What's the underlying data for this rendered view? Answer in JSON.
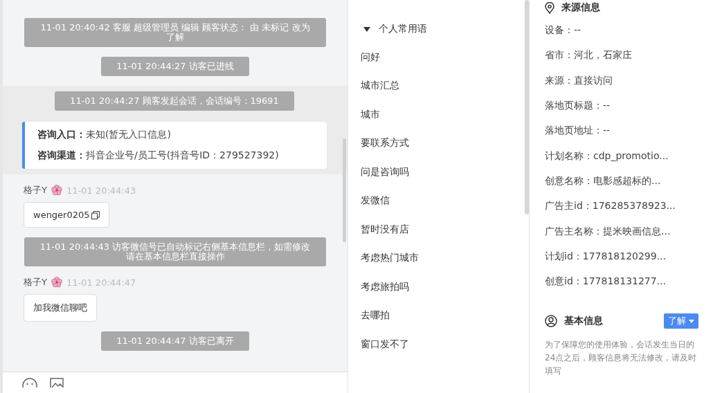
{
  "chat": {
    "messages": [
      {
        "kind": "notice",
        "wide": true,
        "text": "11-01 20:40:42 客服 超级管理员 编辑 顾客状态： 由 未标记 改为了解"
      },
      {
        "kind": "notice",
        "wide": false,
        "text": "11-01 20:44:27 访客已进线"
      },
      {
        "kind": "session",
        "text": "11-01 20:44:27 顾客发起会话，会话编号：19691",
        "fields": [
          {
            "label": "咨询入口：",
            "value": "未知(暂无入口信息)"
          },
          {
            "label": "咨询渠道：",
            "value": "抖音企业号/员工号(抖音号ID：279527392)"
          }
        ]
      },
      {
        "kind": "bubble",
        "sender": "格子Y",
        "time": "11-01 20:44:43",
        "text": "wenger0205",
        "copyable": true
      },
      {
        "kind": "notice",
        "wide": true,
        "text": "11-01 20:44:43 访客微信号已自动标记右侧基本信息栏，如需修改请在基本信息栏直接操作"
      },
      {
        "kind": "bubble",
        "sender": "格子Y",
        "time": "11-01 20:44:47",
        "text": "加我微信聊吧",
        "copyable": false
      },
      {
        "kind": "notice",
        "wide": false,
        "text": "11-01 20:44:47 访客已离开"
      }
    ]
  },
  "phrases": {
    "group": "个人常用语",
    "expanded": true,
    "items": [
      "问好",
      "城市汇总",
      "城市",
      "要联系方式",
      "问是咨询吗",
      "发微信",
      "暂时没有店",
      "考虑热门城市",
      "考虑旅拍吗",
      "去哪拍",
      "窗口发不了"
    ]
  },
  "source_info": {
    "title": "来源信息",
    "rows": [
      "设备：--",
      "省市：河北，石家庄",
      "来源：直接访问",
      "落地页标题：--",
      "落地页地址：--",
      "计划名称：cdp_promotio...",
      "创意名称：电影感超标的...",
      "广告主id：176285378923...",
      "广告主名称：提米映画信息...",
      "计划id：177818120299...",
      "创意id：177818131277..."
    ]
  },
  "basic_info": {
    "title": "基本信息",
    "status": "了解",
    "note": "为了保障您的使用体验，会话发生当日的24点之后，顾客信息将无法修改，请及时填写"
  }
}
